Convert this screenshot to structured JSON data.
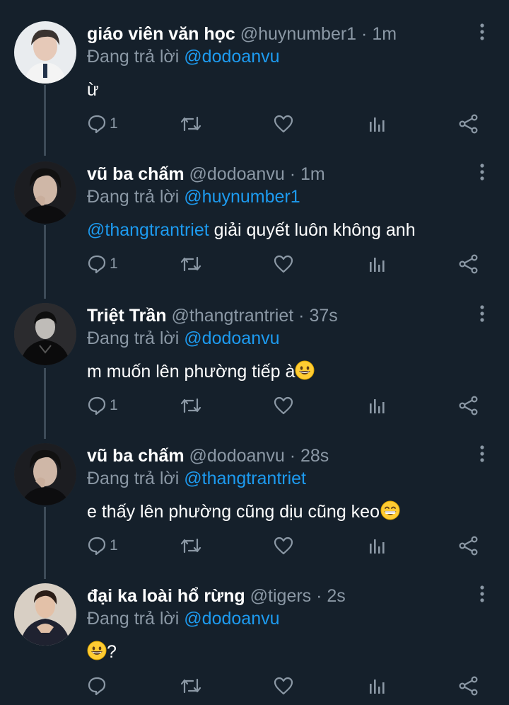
{
  "reply_prefix": "Đang trả lời",
  "colors": {
    "background": "#15202b",
    "mention": "#1d9bf0",
    "muted": "#8b98a5",
    "thread_line": "#3d4b58"
  },
  "tweets": [
    {
      "display_name": "giáo viên văn học",
      "handle": "@huynumber1",
      "separator": "·",
      "time": "1m",
      "reply_to": "@dodoanvu",
      "mention": "",
      "text": "ừ",
      "emoji": "",
      "reply_count": "1"
    },
    {
      "display_name": "vũ ba chấm",
      "handle": "@dodoanvu",
      "separator": "·",
      "time": "1m",
      "reply_to": "@huynumber1",
      "mention": "@thangtrantriet",
      "text": " giải quyết luôn không anh",
      "emoji": "",
      "reply_count": "1"
    },
    {
      "display_name": "Triệt Trần",
      "handle": "@thangtrantriet",
      "separator": "·",
      "time": "37s",
      "reply_to": "@dodoanvu",
      "mention": "",
      "text": "m muốn lên phường tiếp à",
      "emoji": "grinning-face",
      "reply_count": "1"
    },
    {
      "display_name": "vũ ba chấm",
      "handle": "@dodoanvu",
      "separator": "·",
      "time": "28s",
      "reply_to": "@thangtrantriet",
      "mention": "",
      "text": "e thấy lên phường cũng dịu cũng keo",
      "emoji": "beaming-face",
      "reply_count": "1"
    },
    {
      "display_name": "đại ka loài hổ rừng",
      "handle": "@tigers",
      "separator": "·",
      "time": "2s",
      "reply_to": "@dodoanvu",
      "mention": "",
      "text": "?",
      "emoji": "grinning-face",
      "reply_count": ""
    }
  ],
  "icons": {
    "reply": "reply-icon",
    "retweet": "retweet-icon",
    "like": "heart-icon",
    "analytics": "analytics-icon",
    "share": "share-icon",
    "more": "more-vertical-icon"
  }
}
